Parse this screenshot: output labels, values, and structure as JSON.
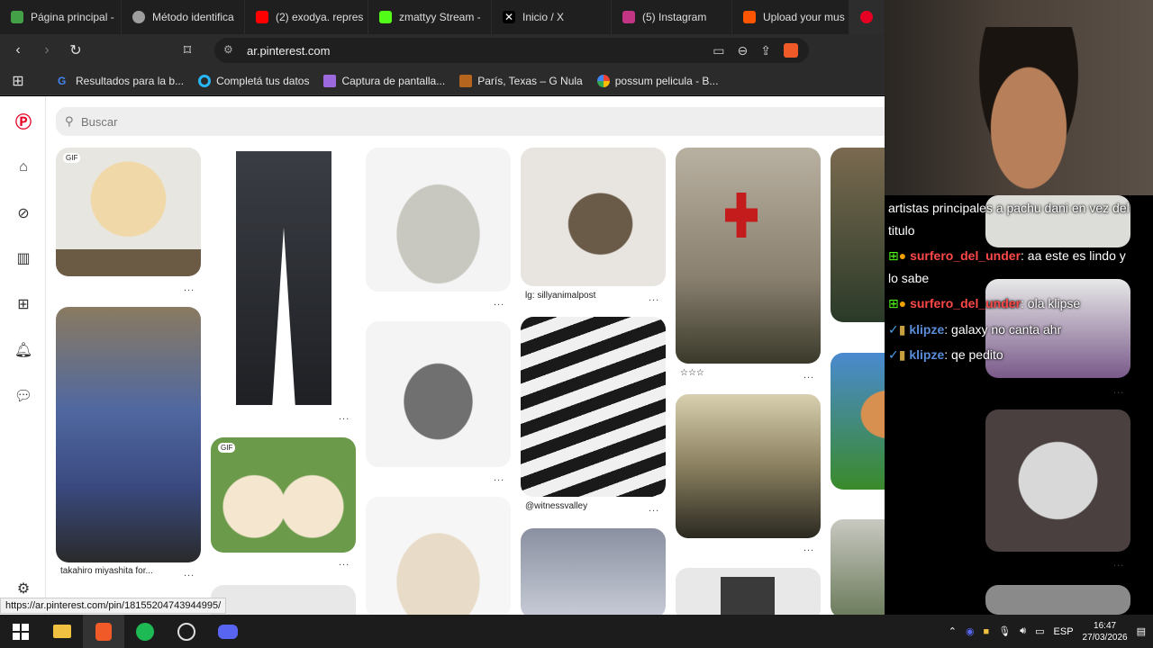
{
  "tabs": [
    {
      "label": "Página principal -",
      "color": "#43a047"
    },
    {
      "label": "Método identifica",
      "color": "#9e9e9e"
    },
    {
      "label": "(2) exodya. repres",
      "color": "#ff0000"
    },
    {
      "label": "zmattyy Stream -",
      "color": "#53fc18"
    },
    {
      "label": "Inicio / X",
      "color": "#ffffff"
    },
    {
      "label": "(5) Instagram",
      "color": "#c13584"
    },
    {
      "label": "Upload your mus",
      "color": "#ff5500"
    },
    {
      "label": "",
      "color": "#e60023"
    }
  ],
  "address": {
    "url": "ar.pinterest.com"
  },
  "bookmarks": [
    {
      "label": "Resultados para la b...",
      "color": "#4285f4"
    },
    {
      "label": "Completá tus datos",
      "color": "#29b6f6"
    },
    {
      "label": "Captura de pantalla...",
      "color": "#9c6ade"
    },
    {
      "label": "París, Texas – G Nula",
      "color": "#b5651d"
    },
    {
      "label": "possum pelicula - B...",
      "color": "#ea4335"
    }
  ],
  "search": {
    "placeholder": "Buscar"
  },
  "pins": {
    "c2": "lg: sillyanimalpost",
    "c3": "@witnessvalley",
    "c4": "☆☆☆",
    "c5": "takahiro miyashita for...",
    "gif": "GIF",
    "more": "..."
  },
  "status_url": "https://ar.pinterest.com/pin/18155204743944995/",
  "chat": {
    "line1": "artistas principales a pachu dani en vez del",
    "line2": "titulo",
    "u1": "surfero_del_under",
    "m1": ": aa este es lindo y",
    "m1b": "lo sabe",
    "m2": ": ola klipse",
    "u2": "klipze",
    "m3": ": galaxy no canta ahr",
    "m4": ": qe pedito"
  },
  "tray": {
    "lang": "ESP",
    "time": "16:47",
    "date": "27/03/2026"
  }
}
